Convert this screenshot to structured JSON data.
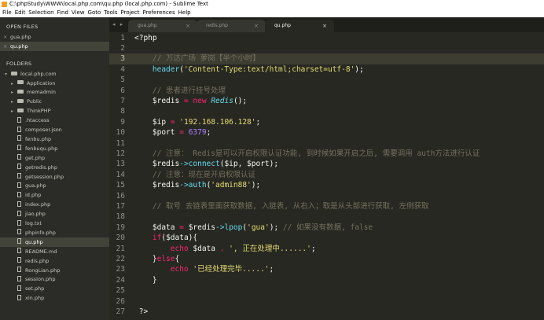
{
  "window": {
    "title": "C:\\phpStudy\\WWW\\local.php.com\\qu.php (local.php.com) - Sublime Text"
  },
  "menu": [
    "File",
    "Edit",
    "Selection",
    "Find",
    "View",
    "Goto",
    "Tools",
    "Project",
    "Preferences",
    "Help"
  ],
  "sidebar": {
    "open_files_title": "OPEN FILES",
    "open_files": [
      {
        "name": "gua.php",
        "active": false
      },
      {
        "name": "qu.php",
        "active": true
      }
    ],
    "folders_title": "FOLDERS",
    "root": "local.php.com",
    "tree": [
      {
        "name": "Application",
        "type": "folder"
      },
      {
        "name": "memadmin",
        "type": "folder"
      },
      {
        "name": "Public",
        "type": "folder"
      },
      {
        "name": "ThinkPHP",
        "type": "folder"
      },
      {
        "name": ".htaccess",
        "type": "file"
      },
      {
        "name": "composer.json",
        "type": "file-json"
      },
      {
        "name": "fenbu.php",
        "type": "file"
      },
      {
        "name": "fenbuqu.php",
        "type": "file"
      },
      {
        "name": "get.php",
        "type": "file"
      },
      {
        "name": "getredis.php",
        "type": "file"
      },
      {
        "name": "getsession.php",
        "type": "file"
      },
      {
        "name": "gua.php",
        "type": "file"
      },
      {
        "name": "id.php",
        "type": "file"
      },
      {
        "name": "index.php",
        "type": "file"
      },
      {
        "name": "jiao.php",
        "type": "file"
      },
      {
        "name": "log.txt",
        "type": "file-txt"
      },
      {
        "name": "phpinfo.php",
        "type": "file"
      },
      {
        "name": "qu.php",
        "type": "file",
        "active": true
      },
      {
        "name": "README.md",
        "type": "file-md"
      },
      {
        "name": "redis.php",
        "type": "file"
      },
      {
        "name": "RongLian.php",
        "type": "file"
      },
      {
        "name": "session.php",
        "type": "file"
      },
      {
        "name": "set.php",
        "type": "file"
      },
      {
        "name": "xin.php",
        "type": "file"
      }
    ]
  },
  "tabs": [
    {
      "name": "gua.php",
      "active": false
    },
    {
      "name": "redis.php",
      "active": false
    },
    {
      "name": "qu.php",
      "active": true
    }
  ],
  "tab_nav": "◂ ▸",
  "tab_close": "×",
  "current_line": 3,
  "code": [
    [
      [
        "pl",
        "<?php"
      ]
    ],
    [],
    [
      [
        "pl",
        "    "
      ],
      [
        "cm",
        "// 万达广场 萝岗【半个小时】"
      ]
    ],
    [
      [
        "pl",
        "    "
      ],
      [
        "fn",
        "header"
      ],
      [
        "pl",
        "("
      ],
      [
        "str",
        "'Content-Type:text/html;charset=utf-8'"
      ],
      [
        "pl",
        ");"
      ]
    ],
    [],
    [
      [
        "pl",
        "    "
      ],
      [
        "cm",
        "// 患者进行挂号处理"
      ]
    ],
    [
      [
        "pl",
        "    "
      ],
      [
        "var",
        "$redis"
      ],
      [
        "pl",
        " "
      ],
      [
        "op",
        "="
      ],
      [
        "pl",
        " "
      ],
      [
        "kw",
        "new"
      ],
      [
        "pl",
        " "
      ],
      [
        "cls",
        "Redis"
      ],
      [
        "pl",
        "();"
      ]
    ],
    [],
    [
      [
        "pl",
        "    "
      ],
      [
        "var",
        "$ip"
      ],
      [
        "pl",
        " "
      ],
      [
        "op",
        "="
      ],
      [
        "pl",
        " "
      ],
      [
        "str",
        "'192.168.106.128'"
      ],
      [
        "pl",
        ";"
      ]
    ],
    [
      [
        "pl",
        "    "
      ],
      [
        "var",
        "$port"
      ],
      [
        "pl",
        " "
      ],
      [
        "op",
        "="
      ],
      [
        "pl",
        " "
      ],
      [
        "num",
        "6379"
      ],
      [
        "pl",
        ";"
      ]
    ],
    [],
    [
      [
        "pl",
        "    "
      ],
      [
        "cm",
        "// 注意： Redis是可以开启权限认证功能, 到时候如果开启之后, 需要调用 auth方法进行认证"
      ]
    ],
    [
      [
        "pl",
        "    "
      ],
      [
        "var",
        "$redis"
      ],
      [
        "ar",
        "->"
      ],
      [
        "fn",
        "connect"
      ],
      [
        "pl",
        "($ip, $port);"
      ]
    ],
    [
      [
        "pl",
        "    "
      ],
      [
        "cm",
        "// 注意：现在是开启权限认证"
      ]
    ],
    [
      [
        "pl",
        "    "
      ],
      [
        "var",
        "$redis"
      ],
      [
        "ar",
        "->"
      ],
      [
        "fn",
        "auth"
      ],
      [
        "pl",
        "("
      ],
      [
        "str",
        "'admin88'"
      ],
      [
        "pl",
        ");"
      ]
    ],
    [],
    [
      [
        "pl",
        "    "
      ],
      [
        "cm",
        "// 取号 去链表里面获取数据, 入链表, 从右入；取是从头部进行获取, 左侧获取"
      ]
    ],
    [],
    [
      [
        "pl",
        "    "
      ],
      [
        "var",
        "$data"
      ],
      [
        "pl",
        " "
      ],
      [
        "op",
        "="
      ],
      [
        "pl",
        " "
      ],
      [
        "var",
        "$redis"
      ],
      [
        "ar",
        "->"
      ],
      [
        "fn",
        "lpop"
      ],
      [
        "pl",
        "("
      ],
      [
        "str",
        "'gua'"
      ],
      [
        "pl",
        "); "
      ],
      [
        "cm",
        "// 如果没有数据, false"
      ]
    ],
    [
      [
        "pl",
        "    "
      ],
      [
        "kw",
        "if"
      ],
      [
        "pl",
        "($data){"
      ]
    ],
    [
      [
        "pl",
        "        "
      ],
      [
        "kw",
        "echo"
      ],
      [
        "pl",
        " $data "
      ],
      [
        "op",
        "."
      ],
      [
        "pl",
        " "
      ],
      [
        "str",
        "', 正在处理中......'"
      ],
      [
        "pl",
        ";"
      ]
    ],
    [
      [
        "pl",
        "    }"
      ],
      [
        "kw",
        "else"
      ],
      [
        "pl",
        "{"
      ]
    ],
    [
      [
        "pl",
        "        "
      ],
      [
        "kw",
        "echo"
      ],
      [
        "pl",
        " "
      ],
      [
        "str",
        "'已经处理完毕.....'"
      ],
      [
        "pl",
        ";"
      ]
    ],
    [
      [
        "pl",
        "    }"
      ]
    ],
    [],
    [],
    [
      [
        "pl",
        " ?>"
      ]
    ]
  ]
}
